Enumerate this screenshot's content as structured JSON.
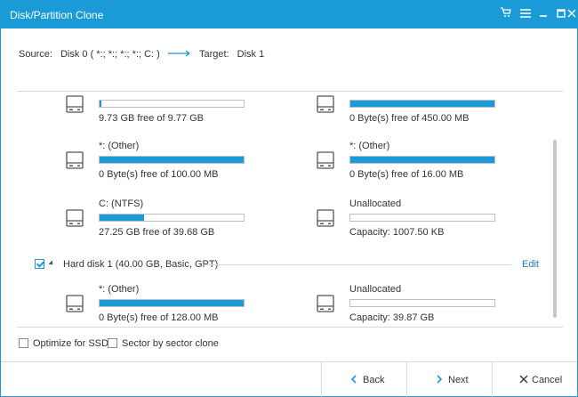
{
  "window": {
    "title": "Disk/Partition Clone"
  },
  "icons": {
    "cart": "cart-icon",
    "menu": "menu-icon",
    "minimize": "minimize-icon",
    "maximize": "maximize-icon",
    "close": "close-icon",
    "disk": "disk-drive-icon",
    "arrow": "arrow-right-icon"
  },
  "source_line": {
    "source_label": "Source:",
    "source_value": "Disk 0 ( *:; *:; *:; *:; C: )",
    "target_label": "Target:",
    "target_value": "Disk 1"
  },
  "partitions_top": [
    {
      "name": "",
      "fill_pct": 1,
      "info": "9.73 GB free of 9.77 GB"
    },
    {
      "name": "",
      "fill_pct": 100,
      "info": "0 Byte(s) free of 450.00 MB"
    },
    {
      "name": "*: (Other)",
      "fill_pct": 100,
      "info": "0 Byte(s) free of 100.00 MB"
    },
    {
      "name": "*: (Other)",
      "fill_pct": 100,
      "info": "0 Byte(s) free of 16.00 MB"
    },
    {
      "name": "C: (NTFS)",
      "fill_pct": 31,
      "info": "27.25 GB free of 39.68 GB"
    },
    {
      "name": "Unallocated",
      "fill_pct": 0,
      "info": "Capacity: 1007.50 KB"
    }
  ],
  "disk1": {
    "checked": true,
    "label": "Hard disk 1 (40.00 GB, Basic, GPT)",
    "edit_label": "Edit"
  },
  "partitions_bottom": [
    {
      "name": "*: (Other)",
      "fill_pct": 100,
      "info": "0 Byte(s) free of 128.00 MB"
    },
    {
      "name": "Unallocated",
      "fill_pct": 0,
      "info": "Capacity: 39.87 GB"
    }
  ],
  "options": {
    "ssd_label": "Optimize for SSD",
    "ssd_checked": false,
    "sector_label": "Sector by sector clone",
    "sector_checked": false
  },
  "footer": {
    "back_label": "Back",
    "next_label": "Next",
    "cancel_label": "Cancel"
  },
  "colors": {
    "accent": "#1a9ad6",
    "border": "#d9d9d9"
  }
}
